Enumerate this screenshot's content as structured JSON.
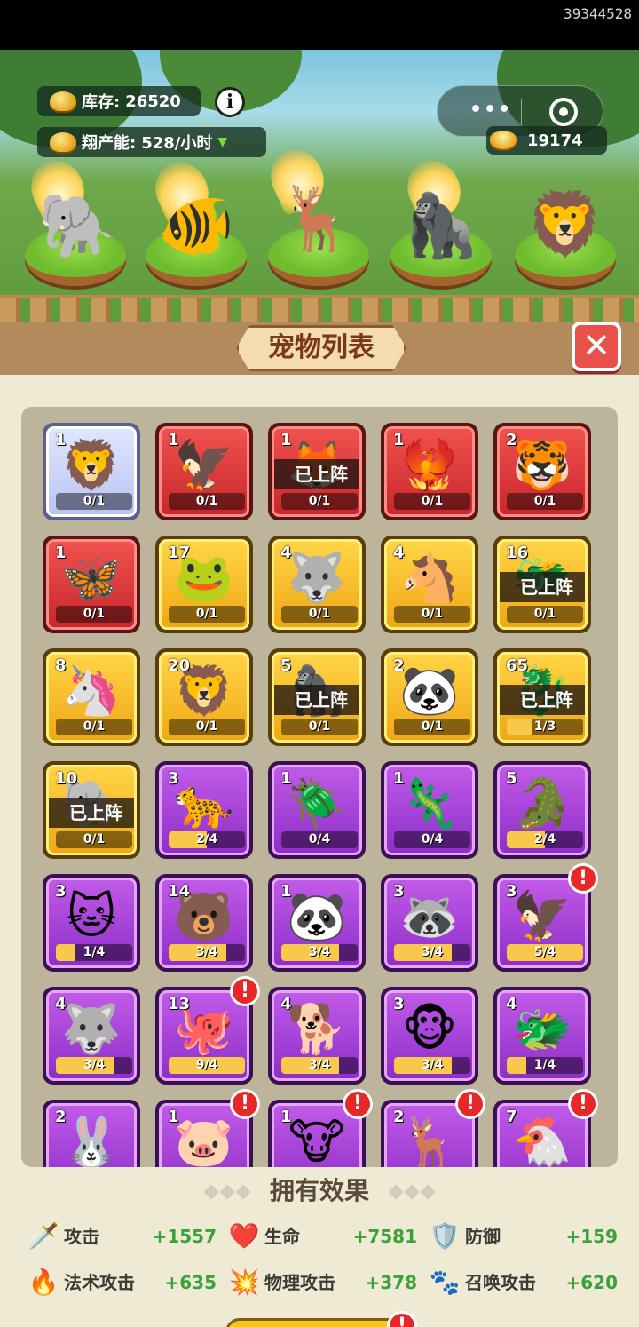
{
  "status": {
    "id": "39344528"
  },
  "hud": {
    "stock_label": "库存:",
    "stock_value": "26520",
    "production_label": "翔产能:",
    "production_value": "528/小时",
    "gold": "19174",
    "info_icon": "info-icon",
    "menu_dots": "•••"
  },
  "team": [
    "elephant",
    "goldfish",
    "deer-spirit",
    "gorilla",
    "phoenix-lion"
  ],
  "panel": {
    "title": "宠物列表",
    "close_icon": "close-icon"
  },
  "deployed_label": "已上阵",
  "pets": [
    {
      "lv": "1",
      "rarity": "blue",
      "emoji": "🦁",
      "count": "0/1",
      "progress": 0
    },
    {
      "lv": "1",
      "rarity": "red",
      "emoji": "🦅",
      "count": "0/1",
      "progress": 0
    },
    {
      "lv": "1",
      "rarity": "red",
      "emoji": "🦊",
      "count": "0/1",
      "progress": 0,
      "deployed": true
    },
    {
      "lv": "1",
      "rarity": "red",
      "emoji": "🐦‍🔥",
      "count": "0/1",
      "progress": 0
    },
    {
      "lv": "2",
      "rarity": "red",
      "emoji": "🐯",
      "count": "0/1",
      "progress": 0
    },
    {
      "lv": "1",
      "rarity": "red",
      "emoji": "🦋",
      "count": "0/1",
      "progress": 0
    },
    {
      "lv": "17",
      "rarity": "gold",
      "emoji": "🐸",
      "count": "0/1",
      "progress": 0
    },
    {
      "lv": "4",
      "rarity": "gold",
      "emoji": "🐺",
      "count": "0/1",
      "progress": 0
    },
    {
      "lv": "4",
      "rarity": "gold",
      "emoji": "🐴",
      "count": "0/1",
      "progress": 0
    },
    {
      "lv": "16",
      "rarity": "gold",
      "emoji": "🐲",
      "count": "0/1",
      "progress": 0,
      "deployed": true
    },
    {
      "lv": "8",
      "rarity": "gold",
      "emoji": "🦄",
      "count": "0/1",
      "progress": 0
    },
    {
      "lv": "20",
      "rarity": "gold",
      "emoji": "🦁",
      "count": "0/1",
      "progress": 0
    },
    {
      "lv": "5",
      "rarity": "gold",
      "emoji": "🦍",
      "count": "0/1",
      "progress": 0,
      "deployed": true
    },
    {
      "lv": "2",
      "rarity": "gold",
      "emoji": "🐼",
      "count": "0/1",
      "progress": 0
    },
    {
      "lv": "65",
      "rarity": "gold",
      "emoji": "🐉",
      "count": "1/3",
      "progress": 0.33,
      "deployed": true
    },
    {
      "lv": "10",
      "rarity": "gold",
      "emoji": "🐘",
      "count": "0/1",
      "progress": 0,
      "deployed": true
    },
    {
      "lv": "3",
      "rarity": "purple",
      "emoji": "🐆",
      "count": "2/4",
      "progress": 0.5
    },
    {
      "lv": "1",
      "rarity": "purple",
      "emoji": "🪲",
      "count": "0/4",
      "progress": 0
    },
    {
      "lv": "1",
      "rarity": "purple",
      "emoji": "🦎",
      "count": "0/4",
      "progress": 0
    },
    {
      "lv": "5",
      "rarity": "purple",
      "emoji": "🐊",
      "count": "2/4",
      "progress": 0.5
    },
    {
      "lv": "3",
      "rarity": "purple",
      "emoji": "🐱",
      "count": "1/4",
      "progress": 0.25
    },
    {
      "lv": "14",
      "rarity": "purple",
      "emoji": "🐻",
      "count": "3/4",
      "progress": 0.75
    },
    {
      "lv": "1",
      "rarity": "purple",
      "emoji": "🐼",
      "count": "3/4",
      "progress": 0.75
    },
    {
      "lv": "3",
      "rarity": "purple",
      "emoji": "🦝",
      "count": "3/4",
      "progress": 0.75
    },
    {
      "lv": "3",
      "rarity": "purple",
      "emoji": "🦅",
      "count": "5/4",
      "progress": 1,
      "alert": true
    },
    {
      "lv": "4",
      "rarity": "purple",
      "emoji": "🐺",
      "count": "3/4",
      "progress": 0.75
    },
    {
      "lv": "13",
      "rarity": "purple",
      "emoji": "🐙",
      "count": "9/4",
      "progress": 1,
      "alert": true
    },
    {
      "lv": "4",
      "rarity": "purple",
      "emoji": "🐕",
      "count": "3/4",
      "progress": 0.75
    },
    {
      "lv": "3",
      "rarity": "purple",
      "emoji": "🐵",
      "count": "3/4",
      "progress": 0.75
    },
    {
      "lv": "4",
      "rarity": "purple",
      "emoji": "🐲",
      "count": "1/4",
      "progress": 0.25
    },
    {
      "lv": "2",
      "rarity": "purple",
      "emoji": "🐰",
      "count": "",
      "progress": 0
    },
    {
      "lv": "1",
      "rarity": "purple",
      "emoji": "🐷",
      "count": "",
      "progress": 0,
      "alert": true
    },
    {
      "lv": "1",
      "rarity": "purple",
      "emoji": "🐮",
      "count": "",
      "progress": 0,
      "alert": true
    },
    {
      "lv": "2",
      "rarity": "purple",
      "emoji": "🦌",
      "count": "",
      "progress": 0,
      "alert": true
    },
    {
      "lv": "7",
      "rarity": "purple",
      "emoji": "🐔",
      "count": "",
      "progress": 0,
      "alert": true
    }
  ],
  "effects": {
    "title": "拥有效果",
    "items": [
      {
        "icon": "🗡️",
        "name": "攻击",
        "value": "+1557"
      },
      {
        "icon": "❤️",
        "name": "生命",
        "value": "+7581"
      },
      {
        "icon": "🛡️",
        "name": "防御",
        "value": "+159"
      },
      {
        "icon": "🔥",
        "name": "法术攻击",
        "value": "+635"
      },
      {
        "icon": "💥",
        "name": "物理攻击",
        "value": "+378"
      },
      {
        "icon": "🐾",
        "name": "召唤攻击",
        "value": "+620"
      }
    ]
  },
  "alert_mark": "!",
  "close_mark": "✕"
}
